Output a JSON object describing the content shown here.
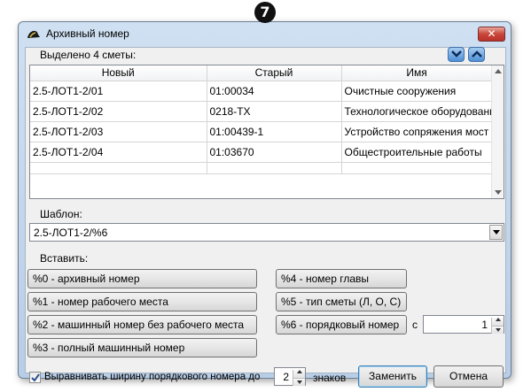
{
  "annotation": {
    "number": "7"
  },
  "window": {
    "title": "Архивный номер",
    "close_glyph": "✕"
  },
  "selection": {
    "label": "Выделено 4 сметы:"
  },
  "grid": {
    "columns": [
      "Новый",
      "Старый",
      "Имя"
    ],
    "rows": [
      [
        "2.5-ЛОТ1-2/01",
        "01:00034",
        "Очистные сооружения"
      ],
      [
        "2.5-ЛОТ1-2/02",
        "0218-ТХ",
        "Технологическое оборудование"
      ],
      [
        "2.5-ЛОТ1-2/03",
        "01:00439-1",
        "Устройство сопряжения мост"
      ],
      [
        "2.5-ЛОТ1-2/04",
        "01:03670",
        "Общестроительные работы"
      ]
    ]
  },
  "template": {
    "label": "Шаблон:",
    "value": "2.5-ЛОТ1-2/%6"
  },
  "insert": {
    "label": "Вставить:",
    "buttons": [
      "%0 - архивный номер",
      "%1 - номер рабочего места",
      "%2 - машинный номер без рабочего места",
      "%3 - полный машинный номер",
      "%4 - номер главы",
      "%5 - тип сметы (Л, О, С)",
      "%6 - порядковый номер"
    ],
    "start_label": "с",
    "start_value": "1"
  },
  "footer": {
    "align_label": "Выравнивать ширину порядкового номера до",
    "align_checked": true,
    "width_value": "2",
    "width_unit": "знаков",
    "replace_button": "Заменить",
    "cancel_button": "Отмена"
  },
  "icons": {
    "app": "hat-icon",
    "close": "close-icon",
    "move_down": "chevron-down-icon",
    "move_up": "chevron-up-icon",
    "dropdown": "dropdown-arrow-icon"
  },
  "colors": {
    "title_gradient_top": "#cfe0f2",
    "close_button": "#c9463a",
    "arrow_buttons": "#4f8fd6"
  }
}
